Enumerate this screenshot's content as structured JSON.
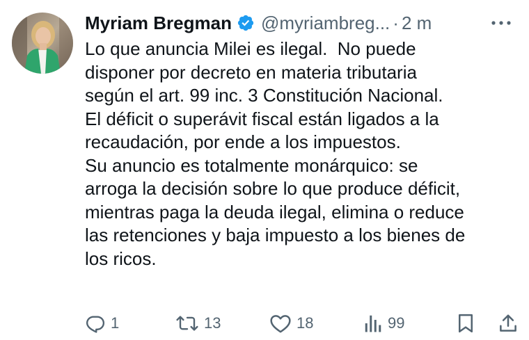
{
  "author": {
    "display_name": "Myriam Bregman",
    "handle": "@myriambreg...",
    "separator": "·",
    "time": "2 m"
  },
  "tweet": {
    "lines": [
      "Lo que anuncia Milei es ilegal.  No puede",
      "disponer por decreto en materia tributaria",
      "según el art. 99 inc. 3 Constitución Nacional.",
      "El déficit o superávit fiscal están ligados a la",
      "recaudación, por ende a los impuestos.",
      "Su anuncio es totalmente monárquico: se",
      "arroga la decisión sobre lo que produce déficit,",
      "mientras paga la deuda ilegal, elimina o reduce",
      "las retenciones y baja impuesto a los bienes de",
      "los ricos."
    ]
  },
  "actions": {
    "replies": "1",
    "reposts": "13",
    "likes": "18",
    "views": "99"
  },
  "icons": {
    "verified": "verified-badge-icon",
    "more": "more-horizontal-icon",
    "reply": "reply-icon",
    "repost": "repost-icon",
    "like": "heart-icon",
    "views": "views-chart-icon",
    "bookmark": "bookmark-icon",
    "share": "share-icon"
  },
  "colors": {
    "text": "#0f1419",
    "secondary": "#536471",
    "verified": "#1d9bf0"
  }
}
